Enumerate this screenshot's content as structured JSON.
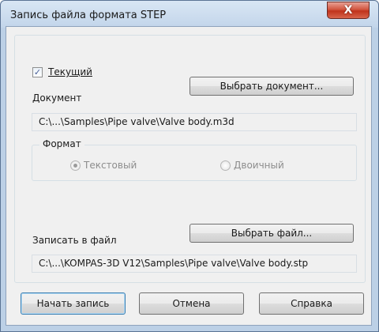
{
  "window": {
    "title": "Запись файла формата STEP",
    "close_glyph": "X"
  },
  "current_checkbox": {
    "checked": true,
    "label": "Текущий",
    "check_glyph": "✓"
  },
  "document": {
    "label": "Документ",
    "select_button": "Выбрать документ...",
    "path": "C:\\...\\Samples\\Pipe valve\\Valve body.m3d"
  },
  "format": {
    "legend": "Формат",
    "options": [
      {
        "label": "Текстовый",
        "selected": true
      },
      {
        "label": "Двоичный",
        "selected": false
      }
    ]
  },
  "output_file": {
    "label": "Записать в файл",
    "select_button": "Выбрать файл...",
    "path": "C:\\...\\KOMPAS-3D V12\\Samples\\Pipe valve\\Valve body.stp"
  },
  "buttons": {
    "start": "Начать запись",
    "cancel": "Отмена",
    "help": "Справка"
  },
  "icons": {
    "close": "close-icon",
    "checkbox": "checkmark-icon",
    "radio": "radio-icon"
  }
}
